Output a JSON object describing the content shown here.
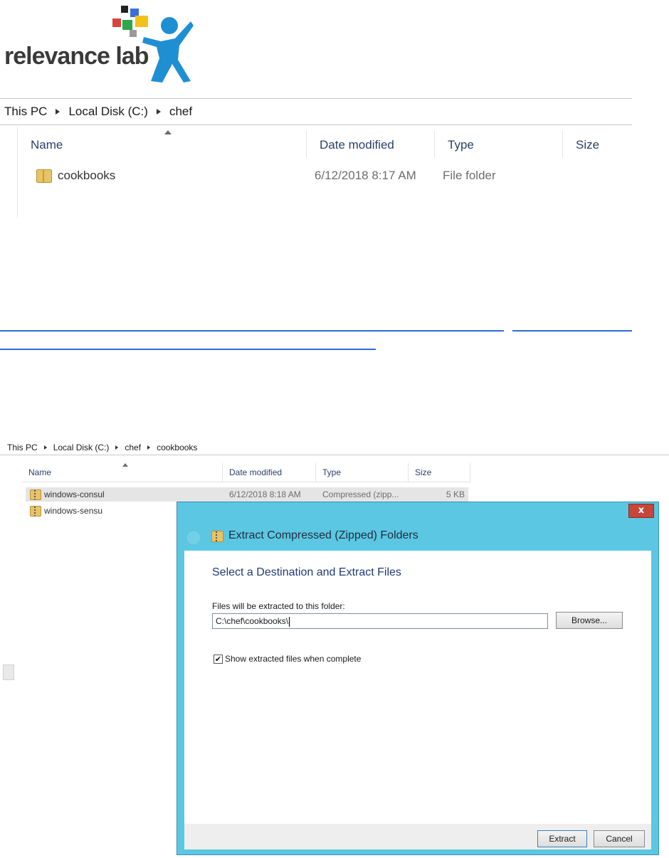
{
  "logo": {
    "text": "relevance lab"
  },
  "explorer_top": {
    "breadcrumb": [
      "This PC",
      "Local Disk (C:)",
      "chef"
    ],
    "columns": [
      "Name",
      "Date modified",
      "Type",
      "Size"
    ],
    "rows": [
      {
        "name": "cookbooks",
        "date": "6/12/2018 8:17 AM",
        "type": "File folder",
        "size": ""
      }
    ]
  },
  "explorer_bottom": {
    "breadcrumb": [
      "This PC",
      "Local Disk (C:)",
      "chef",
      "cookbooks"
    ],
    "columns": [
      "Name",
      "Date modified",
      "Type",
      "Size"
    ],
    "rows": [
      {
        "name": "windows-consul",
        "date": "6/12/2018 8:18 AM",
        "type": "Compressed (zipp...",
        "size": "5 KB"
      },
      {
        "name": "windows-sensu",
        "date": "",
        "type": "",
        "size": ""
      }
    ]
  },
  "dialog": {
    "title": "Extract Compressed (Zipped) Folders",
    "heading": "Select a Destination and Extract Files",
    "label": "Files will be extracted to this folder:",
    "path_value": "C:\\chef\\cookbooks\\",
    "browse_label": "Browse...",
    "checkbox_label": "Show extracted files when complete",
    "checkbox_checked": true,
    "extract_label": "Extract",
    "cancel_label": "Cancel",
    "close_label": "x"
  },
  "colors": {
    "dialog_frame": "#5bc7e3",
    "link": "#2b6bd3",
    "close_button": "#c7463a"
  }
}
